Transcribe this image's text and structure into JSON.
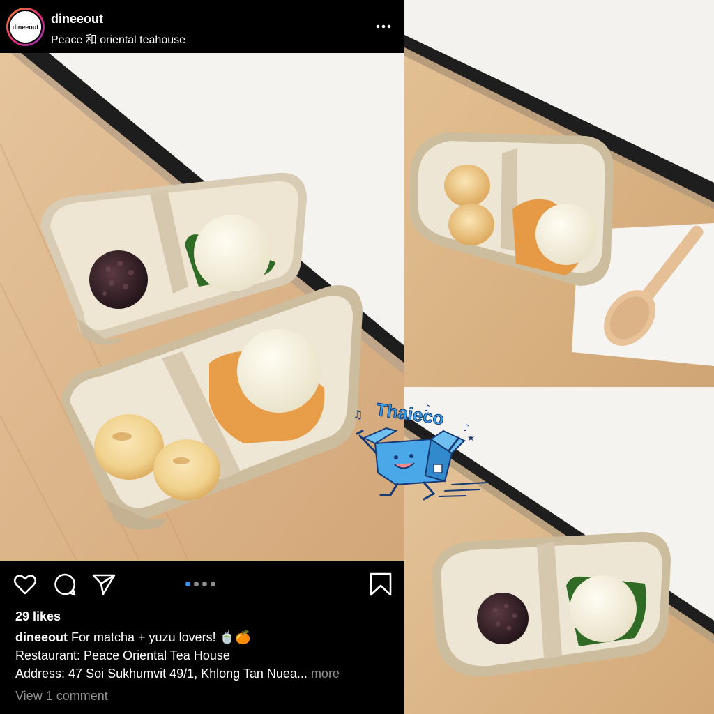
{
  "post": {
    "username": "dineeout",
    "location": "Peace 和 oriental teahouse",
    "avatar_text": "dineeout",
    "likes": "29 likes",
    "caption_username": "dineeout",
    "caption_text": "For matcha + yuzu lovers! 🍵🍊",
    "restaurant_line": "Restaurant: Peace Oriental Tea House",
    "address_line": "Address: 47 Soi Sukhumvit 49/1, Khlong Tan Nuea...",
    "more_label": "more",
    "view_comments": "View 1 comment",
    "carousel": {
      "count": 4,
      "active": 1
    }
  },
  "icons": {
    "more": "more-options-icon",
    "like": "heart-icon",
    "comment": "comment-icon",
    "share": "share-icon",
    "save": "bookmark-icon"
  },
  "sticker": {
    "text": "Thaieco"
  },
  "colors": {
    "background": "#000000",
    "text": "#ffffff",
    "muted": "#8e8e8e",
    "accent": "#3897f0"
  }
}
